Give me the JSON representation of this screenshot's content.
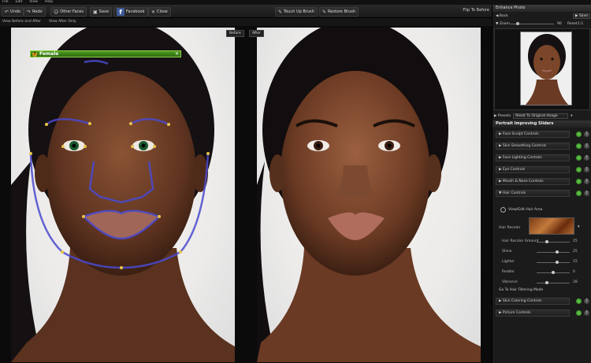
{
  "menu": [
    "File",
    "Edit",
    "View",
    "Help"
  ],
  "toolbar": {
    "undo": "Undo",
    "redo": "Redo",
    "other_faces": "Other Faces",
    "save": "Save",
    "facebook": "Facebook",
    "close": "Close",
    "touch_up": "Touch Up Brush",
    "restore": "Restore Brush",
    "flip": "Flip To Before"
  },
  "view_bar": {
    "before_after": "View Before and After",
    "after_only": "View After Only"
  },
  "photos": {
    "before_label": "Before",
    "after_label": "After",
    "face_tag": "Female"
  },
  "panel": {
    "title": "Enhance Photo",
    "back": "Back",
    "save": "Save",
    "zoom_label": "Zoom",
    "zoom_value": "90",
    "zoom_reset": "Reset",
    "zoom_ratio": "1:1",
    "presets_label": "Presets",
    "presets_value": "Reset To Original Image",
    "section": "Portrait Improving Sliders",
    "controls": [
      "Face Sculpt Controls",
      "Skin Smoothing Controls",
      "Face Lighting Controls",
      "Eye Controls",
      "Mouth & Nose Controls",
      "Hair Controls"
    ],
    "hair_brush": "View/Edit Hair Area",
    "hair_recolor": "Hair Recolor",
    "sliders": [
      {
        "name": "Hair Recolor Amount",
        "value": "25",
        "level": 0.32
      },
      {
        "name": "Shine",
        "value": "25",
        "level": 0.62
      },
      {
        "name": "Lighter",
        "value": "15",
        "level": 0.62
      },
      {
        "name": "Redder",
        "value": "0",
        "level": 0.5
      },
      {
        "name": "Vibrance",
        "value": "28",
        "level": 0.3
      }
    ],
    "goto_face": "Go To Hair Filtering Mode",
    "bottom_controls": [
      "Skin Coloring Controls",
      "Picture Controls"
    ]
  }
}
